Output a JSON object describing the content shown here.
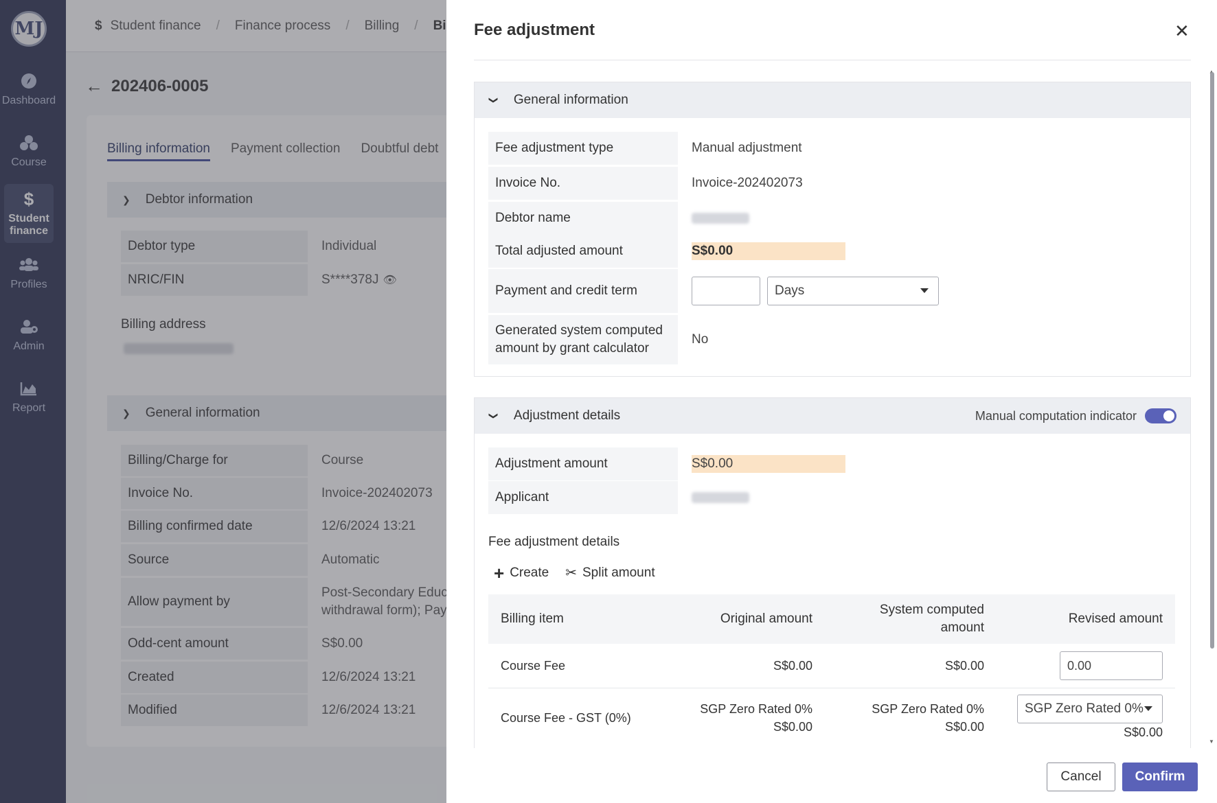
{
  "sidebar": {
    "logo": "MJ",
    "items": [
      {
        "label": "Dashboard",
        "icon": "compass-icon"
      },
      {
        "label": "Course",
        "icon": "course-icon"
      },
      {
        "label": "Student\nfinance",
        "icon": "dollar-icon",
        "active": true
      },
      {
        "label": "Profiles",
        "icon": "people-icon"
      },
      {
        "label": "Admin",
        "icon": "admin-icon"
      },
      {
        "label": "Report",
        "icon": "chart-icon"
      }
    ]
  },
  "breadcrumb": [
    "Student finance",
    "Finance process",
    "Billing",
    "Bil"
  ],
  "page": {
    "title": "202406-0005",
    "tabs": [
      "Billing information",
      "Payment collection",
      "Doubtful debt"
    ],
    "debtor": {
      "heading": "Debtor information",
      "debtor_type_label": "Debtor type",
      "debtor_type_value": "Individual",
      "nric_label": "NRIC/FIN",
      "nric_value": "S****378J",
      "billing_address_label": "Billing address"
    },
    "general": {
      "heading": "General information",
      "rows": [
        {
          "label": "Billing/Charge for",
          "value": "Course"
        },
        {
          "label": "Invoice No.",
          "value": "Invoice-202402073"
        },
        {
          "label": "Billing confirmed date",
          "value": "12/6/2024 13:21"
        },
        {
          "label": "Source",
          "value": "Automatic"
        },
        {
          "label": "Allow payment by",
          "value": "Post-Secondary Educa",
          "value2": "withdrawal form); Pay"
        },
        {
          "label": "Odd-cent amount",
          "value": "S$0.00"
        },
        {
          "label": "Created",
          "value": "12/6/2024 13:21"
        },
        {
          "label": "Modified",
          "value": "12/6/2024 13:21"
        }
      ]
    }
  },
  "drawer": {
    "title": "Fee adjustment",
    "general": {
      "heading": "General information",
      "fee_adjustment_type_label": "Fee adjustment type",
      "fee_adjustment_type_value": "Manual adjustment",
      "invoice_label": "Invoice No.",
      "invoice_value": "Invoice-202402073",
      "debtor_name_label": "Debtor name",
      "total_adjusted_label": "Total adjusted amount",
      "total_adjusted_value": "S$0.00",
      "payment_term_label": "Payment and credit term",
      "payment_term_value": "",
      "payment_term_unit": "Days",
      "grant_calc_label_1": "Generated system computed",
      "grant_calc_label_2": "amount by grant calculator",
      "grant_calc_value": "No"
    },
    "adjustment": {
      "heading": "Adjustment details",
      "manual_indicator_label": "Manual computation indicator",
      "manual_indicator_on": true,
      "adjustment_amount_label": "Adjustment amount",
      "adjustment_amount_value": "S$0.00",
      "applicant_label": "Applicant",
      "details_heading": "Fee adjustment details",
      "create_label": "Create",
      "split_label": "Split amount",
      "table": {
        "headers": [
          "Billing item",
          "Original amount",
          "System computed amount",
          "Revised amount"
        ],
        "rows": [
          {
            "item": "Course Fee",
            "original": "S$0.00",
            "system": "S$0.00",
            "revised": "0.00"
          },
          {
            "item": "Course Fee - GST (0%)",
            "original_tax": "SGP Zero Rated 0%",
            "original": "S$0.00",
            "system_tax": "SGP Zero Rated 0%",
            "system": "S$0.00",
            "revised_tax": "SGP Zero Rated 0%",
            "revised": "S$0.00"
          }
        ]
      }
    },
    "cancel_label": "Cancel",
    "confirm_label": "Confirm"
  }
}
